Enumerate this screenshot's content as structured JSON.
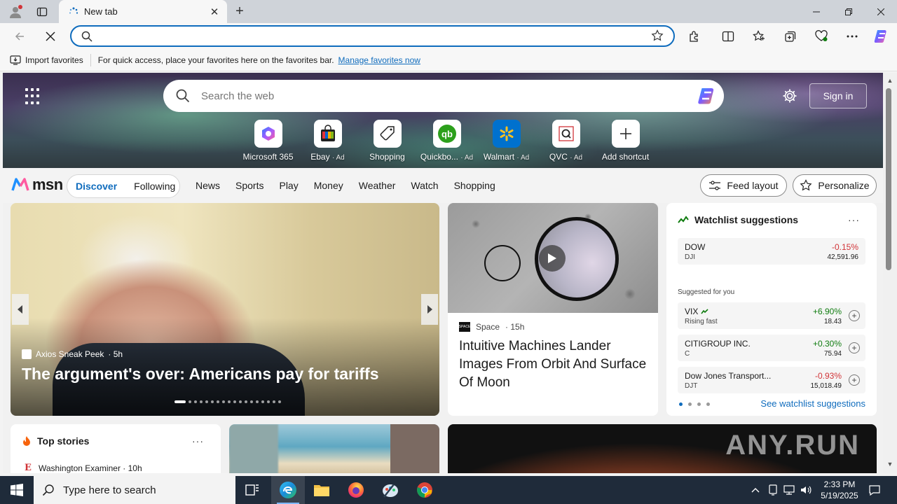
{
  "browser": {
    "tab_title": "New tab",
    "new_tab_symbol": "+",
    "close_tab_symbol": "✕",
    "address_value": "",
    "favbar": {
      "import_label": "Import favorites",
      "hint": "For quick access, place your favorites here on the favorites bar.",
      "manage_link": "Manage favorites now"
    }
  },
  "newtab": {
    "search_placeholder": "Search the web",
    "signin_label": "Sign in",
    "shortcuts": [
      {
        "label": "Microsoft 365",
        "ad": ""
      },
      {
        "label": "Ebay",
        "ad": "· Ad"
      },
      {
        "label": "Shopping",
        "ad": ""
      },
      {
        "label": "Quickbo...",
        "ad": "· Ad"
      },
      {
        "label": "Walmart",
        "ad": "· Ad"
      },
      {
        "label": "QVC",
        "ad": "· Ad"
      },
      {
        "label": "Add shortcut",
        "ad": ""
      }
    ]
  },
  "msn": {
    "logo_text": "msn",
    "pill": [
      "Discover",
      "Following"
    ],
    "nav": [
      "News",
      "Sports",
      "Play",
      "Money",
      "Weather",
      "Watch",
      "Shopping"
    ],
    "feed_layout_label": "Feed layout",
    "personalize_label": "Personalize"
  },
  "hero_story": {
    "source": "Axios Sneak Peek",
    "age": "· 5h",
    "title": "The argument's over: Americans pay for tariffs",
    "slide_count": 18,
    "active_slide": 1
  },
  "moon_story": {
    "source": "Space",
    "age": "· 15h",
    "source_logo_text": "SPACE",
    "title": "Intuitive Machines Lander Images From Orbit And Surface Of Moon"
  },
  "watchlist": {
    "title": "Watchlist suggestions",
    "more": "···",
    "pinned": {
      "name": "DOW",
      "symbol": "DJI",
      "change": "-0.15%",
      "price": "42,591.96"
    },
    "suggested_label": "Suggested for you",
    "suggested": [
      {
        "name": "VIX",
        "symbol": "Rising fast",
        "change": "+6.90%",
        "price": "18.43"
      },
      {
        "name": "CITIGROUP INC.",
        "symbol": "C",
        "change": "+0.30%",
        "price": "75.94"
      },
      {
        "name": "Dow Jones Transport...",
        "symbol": "DJT",
        "change": "-0.93%",
        "price": "15,018.49"
      }
    ],
    "see_link": "See watchlist suggestions",
    "page_count": 4,
    "active_page": 1
  },
  "top_stories": {
    "title": "Top stories",
    "more": "···",
    "first_source": "Washington Examiner · 10h"
  },
  "watermark": "ANY.RUN",
  "taskbar": {
    "search_placeholder": "Type here to search",
    "time": "2:33 PM",
    "date": "5/19/2025"
  },
  "colors": {
    "accent": "#0f6cbd",
    "negative": "#d13438",
    "positive": "#107c10"
  }
}
